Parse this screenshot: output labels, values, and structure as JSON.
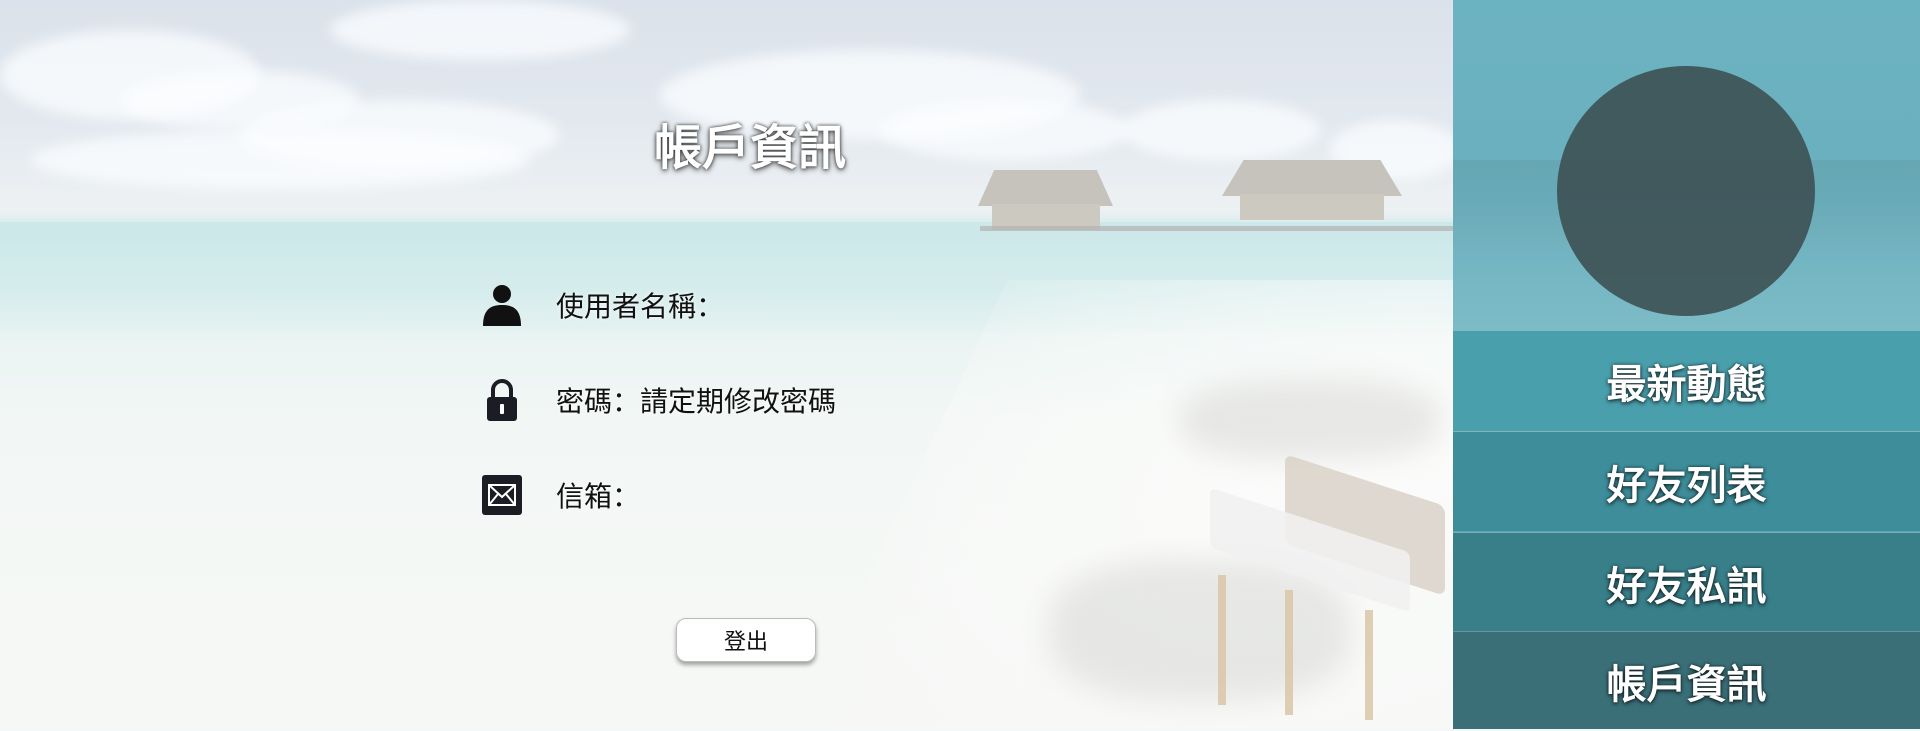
{
  "main": {
    "title": "帳戶資訊",
    "fields": [
      {
        "icon": "user-icon",
        "label": "使用者名稱："
      },
      {
        "icon": "lock-icon",
        "label": "密碼：請定期修改密碼"
      },
      {
        "icon": "mail-icon",
        "label": "信箱："
      }
    ],
    "logout_label": "登出"
  },
  "sidebar": {
    "items": [
      {
        "label": "最新動態"
      },
      {
        "label": "好友列表"
      },
      {
        "label": "好友私訊"
      },
      {
        "label": "帳戶資訊"
      }
    ]
  },
  "colors": {
    "sidebar_top": "#6cb3c1",
    "sidebar_item_1": "#4a9fac",
    "sidebar_item_4": "#3a6f78",
    "avatar": "#3e5256"
  }
}
